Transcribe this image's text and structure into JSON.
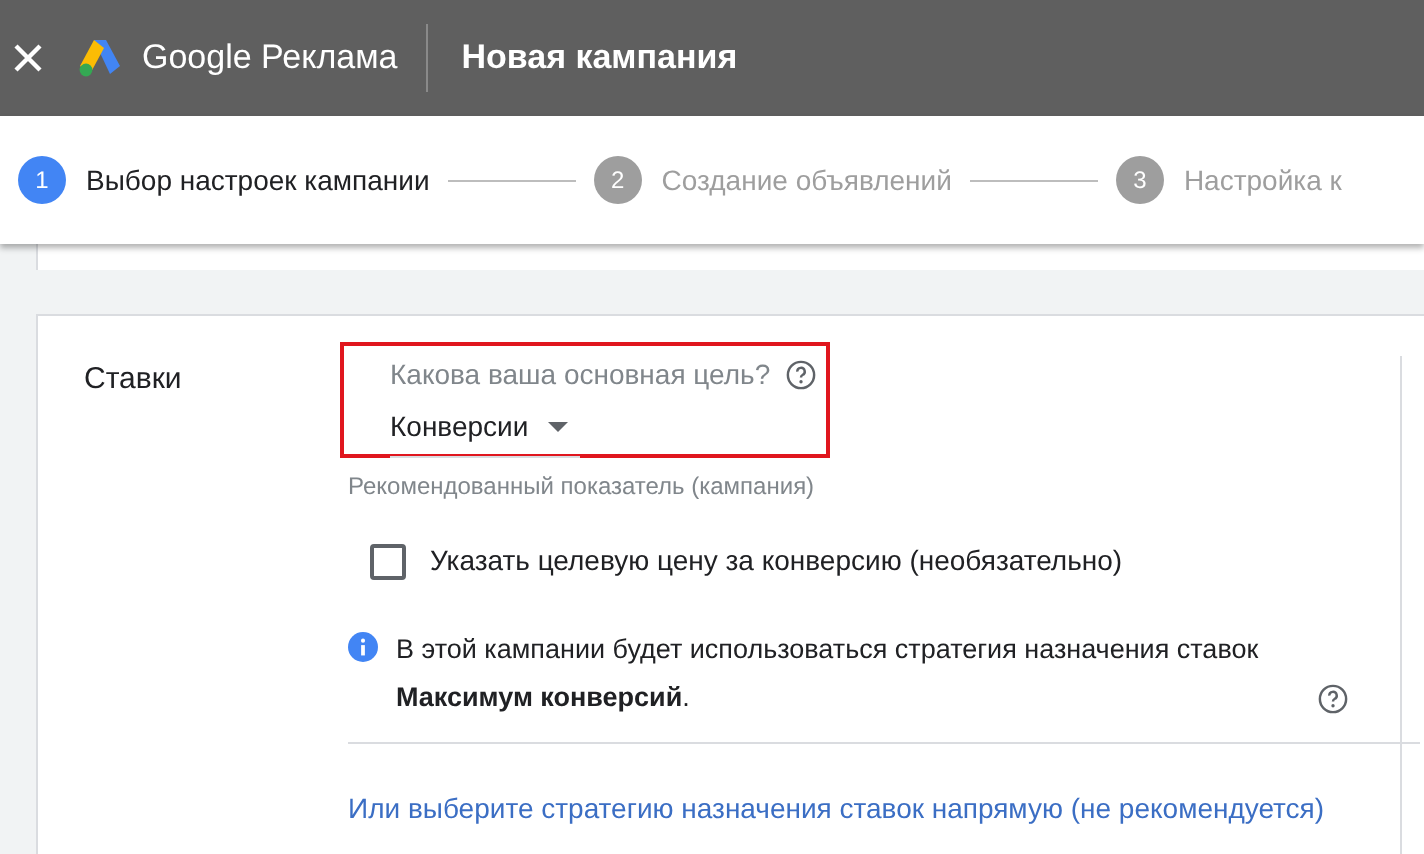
{
  "header": {
    "product": "Google Реклама",
    "title": "Новая кампания"
  },
  "steps": [
    {
      "number": "1",
      "label": "Выбор настроек кампании",
      "selected": true
    },
    {
      "number": "2",
      "label": "Создание объявлений",
      "selected": false
    },
    {
      "number": "3",
      "label": "Настройка к",
      "selected": false
    }
  ],
  "section": {
    "label": "Ставки",
    "goal": {
      "label": "Какова ваша основная цель?",
      "value": "Конверсии",
      "highlighted": true
    },
    "hint": "Рекомендованный показатель (кампания)",
    "checkbox": {
      "label": "Указать целевую цену за конверсию (необязательно)",
      "checked": false
    },
    "info": "В этой кампании будет использоваться стратегия назначения ставок **Максимум конверсий**.",
    "link": "Или выберите стратегию назначения ставок напрямую (не рекомендуется)"
  }
}
